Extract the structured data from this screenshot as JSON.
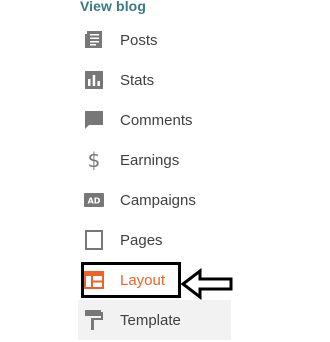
{
  "header": {
    "view_blog_label": "View blog"
  },
  "sidebar": {
    "items": [
      {
        "label": "Posts",
        "icon": "posts-icon"
      },
      {
        "label": "Stats",
        "icon": "stats-icon"
      },
      {
        "label": "Comments",
        "icon": "comments-icon"
      },
      {
        "label": "Earnings",
        "icon": "dollar-icon"
      },
      {
        "label": "Campaigns",
        "icon": "ad-icon"
      },
      {
        "label": "Pages",
        "icon": "page-icon"
      },
      {
        "label": "Layout",
        "icon": "layout-icon",
        "active": true
      },
      {
        "label": "Template",
        "icon": "paint-roller-icon"
      }
    ]
  },
  "colors": {
    "link": "#3b7a83",
    "active": "#e8642c",
    "icon": "#777777",
    "text": "#404040",
    "highlight_border": "#000000"
  }
}
